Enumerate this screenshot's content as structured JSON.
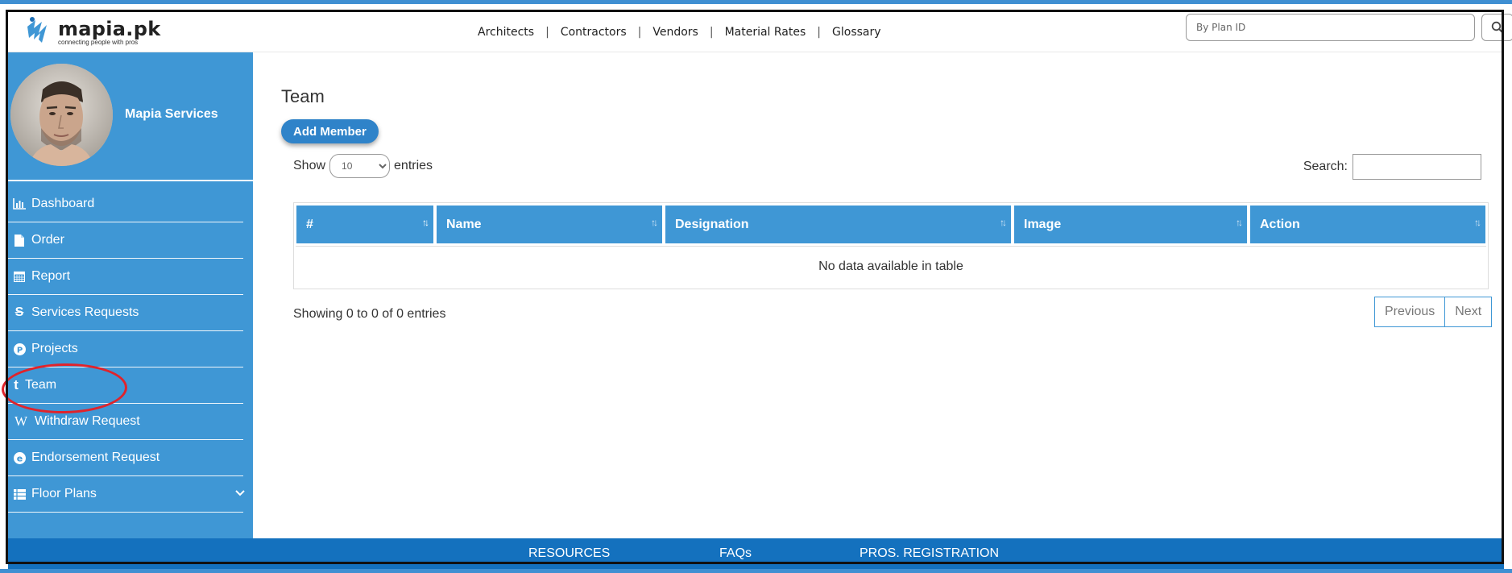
{
  "header": {
    "logo_title": "mapia.pk",
    "logo_tagline": "connecting people with pros",
    "nav": [
      "Architects",
      "Contractors",
      "Vendors",
      "Material Rates",
      "Glossary"
    ],
    "search_placeholder": "By Plan ID",
    "search_icon": "search-icon"
  },
  "sidebar": {
    "profile_name": "Mapia Services",
    "items": [
      {
        "label": "Dashboard",
        "icon": "bar-chart-icon"
      },
      {
        "label": "Order",
        "icon": "file-icon"
      },
      {
        "label": "Report",
        "icon": "calendar-icon"
      },
      {
        "label": "Services Requests",
        "icon": "strike-s-icon"
      },
      {
        "label": "Projects",
        "icon": "p-circle-icon"
      },
      {
        "label": "Team",
        "icon": "t-letter-icon"
      },
      {
        "label": "Withdraw Request",
        "icon": "w-letter-icon"
      },
      {
        "label": "Endorsement Request",
        "icon": "e-circle-icon"
      },
      {
        "label": "Floor Plans",
        "icon": "table-icon",
        "has_chevron": true
      }
    ]
  },
  "main": {
    "title": "Team",
    "add_member_label": "Add Member",
    "show_label": "Show",
    "entries_value": "10",
    "entries_label": "entries",
    "search_label": "Search:",
    "table": {
      "columns": [
        "#",
        "Name",
        "Designation",
        "Image",
        "Action"
      ],
      "empty_message": "No data available in table"
    },
    "info": "Showing 0 to 0 of 0 entries",
    "pager": {
      "previous": "Previous",
      "next": "Next"
    }
  },
  "footer": {
    "links": [
      "RESOURCES",
      "FAQs",
      "PROS. REGISTRATION"
    ]
  },
  "colors": {
    "sidebar_bg": "#3f97d5",
    "footer_bg": "#1471be",
    "button_bg": "#2f83c9",
    "highlight_ellipse": "#e0232b"
  }
}
